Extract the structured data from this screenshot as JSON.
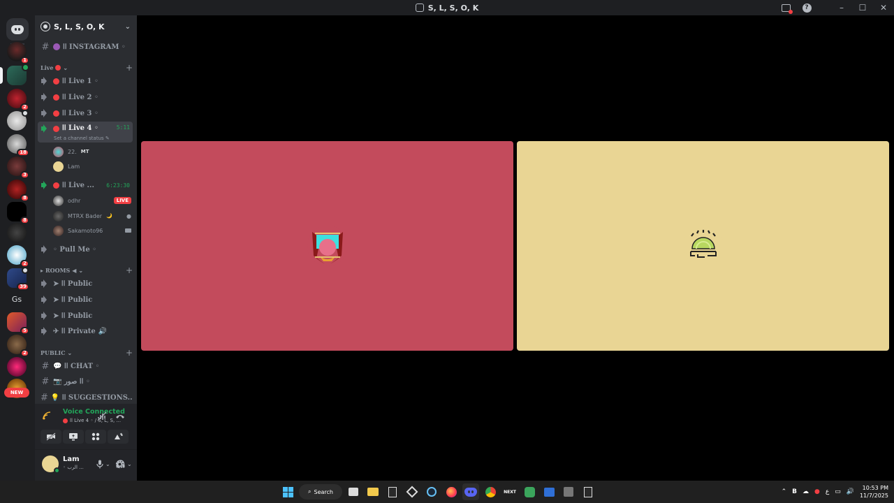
{
  "window": {
    "title": "S, L, S, O, K",
    "min_glyph": "–",
    "max_glyph": "☐",
    "close_glyph": "✕",
    "help_glyph": "?"
  },
  "rail": {
    "badges": [
      "1",
      "2",
      "18",
      "3",
      "8",
      "8",
      "2",
      "39",
      "5",
      "2"
    ],
    "gs_label": "Gs",
    "new_label": "NEW"
  },
  "server": {
    "name": "S, L, S, O, K"
  },
  "channels": {
    "instagram": "اا INSTAGRAM ◦",
    "live_category": "Live",
    "live1": "اا Live 1 ◦",
    "live2": "اا Live 2 ◦",
    "live3": "اا Live 3 ◦",
    "live4": "اا Live 4 ◦",
    "live4_timer": "5:11",
    "live4_status": "Set a channel status",
    "live4_users": [
      {
        "name": "22.",
        "tag": "MT"
      },
      {
        "name": "Lam",
        "tag": ""
      }
    ],
    "live5": "اا Live ...",
    "live5_timer": "6:23:30",
    "live5_users": [
      {
        "name": "odhr",
        "tag": "LIVE"
      },
      {
        "name": "MTRX Bader",
        "tag": "🌙"
      },
      {
        "name": "Sakamoto96",
        "tag": ""
      }
    ],
    "pullme": "◦ Pull Me ◦",
    "rooms_category": "ROOMS",
    "public1": "➤ اا Public",
    "public2": "➤ اا Public",
    "public3": "➤ اا Public",
    "private": "✈ اا Private",
    "public_category": "PUBLIC",
    "chat": "💬 اا CHAT ◦",
    "pics": "📷 اا صور ◦",
    "suggestions": "💡 اا SUGGESTIONS..."
  },
  "voice": {
    "status": "Voice Connected",
    "sub": "اا Live 4 ◦ / S, L, S, ..."
  },
  "user": {
    "name": "Lam",
    "status": "◦ الرب ..."
  },
  "taskbar": {
    "search_label": "Search",
    "time": "10:53 PM",
    "date": "11/7/2025",
    "lang": "ع"
  },
  "colors": {
    "tile_a": "#c34b5c",
    "tile_b": "#e9d594",
    "voice_green": "#23a55a",
    "red": "#f23f43"
  }
}
